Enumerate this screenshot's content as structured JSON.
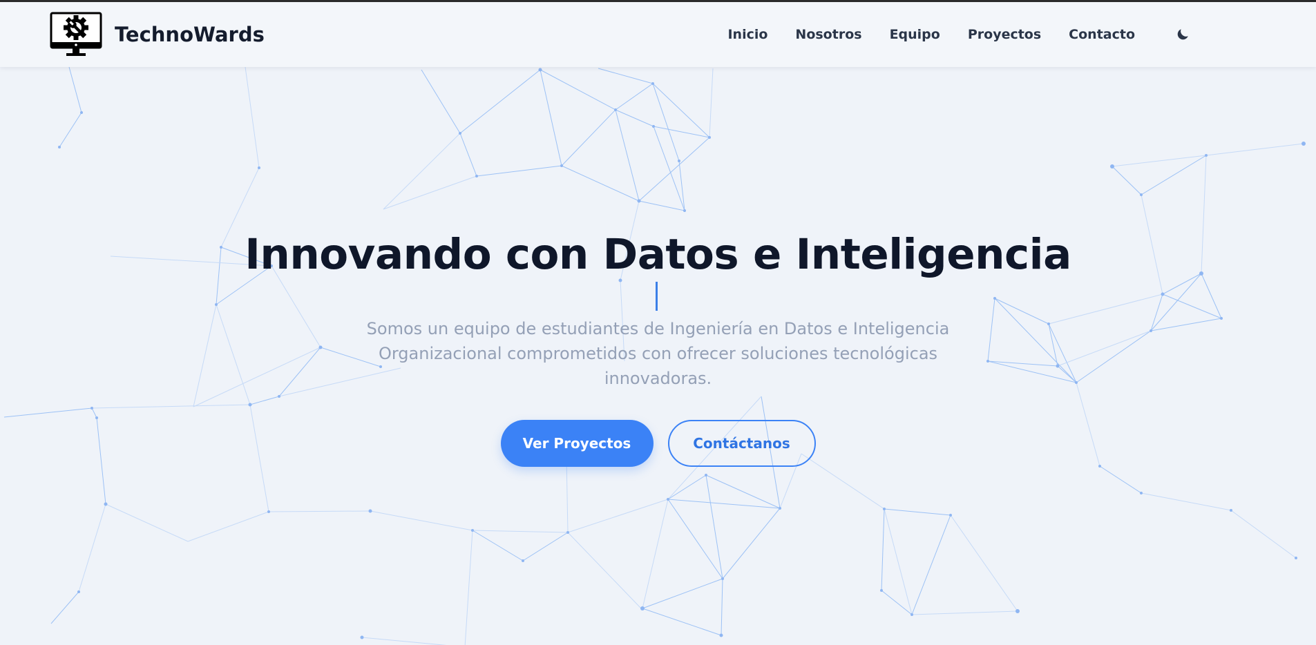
{
  "header": {
    "brand_name": "TechnoWards",
    "logo_icon": "monitor-gear-wrench-icon",
    "nav_items": [
      {
        "label": "Inicio"
      },
      {
        "label": "Nosotros"
      },
      {
        "label": "Equipo"
      },
      {
        "label": "Proyectos"
      },
      {
        "label": "Contacto"
      }
    ],
    "theme_toggle_icon": "moon-icon"
  },
  "hero": {
    "title": "Innovando con Datos e Inteligencia",
    "subtitle": "Somos un equipo de estudiantes de Ingeniería en Datos e Inteligencia Organizacional comprometidos con ofrecer soluciones tecnológicas innovadoras.",
    "primary_button": "Ver Proyectos",
    "secondary_button": "Contáctanos"
  },
  "colors": {
    "accent": "#3b82f6",
    "title": "#0f172a",
    "subtitle": "#94a0b6",
    "background": "#eff3f9",
    "network_lines": "#9cc1f5"
  },
  "background_decoration": "particle-network"
}
